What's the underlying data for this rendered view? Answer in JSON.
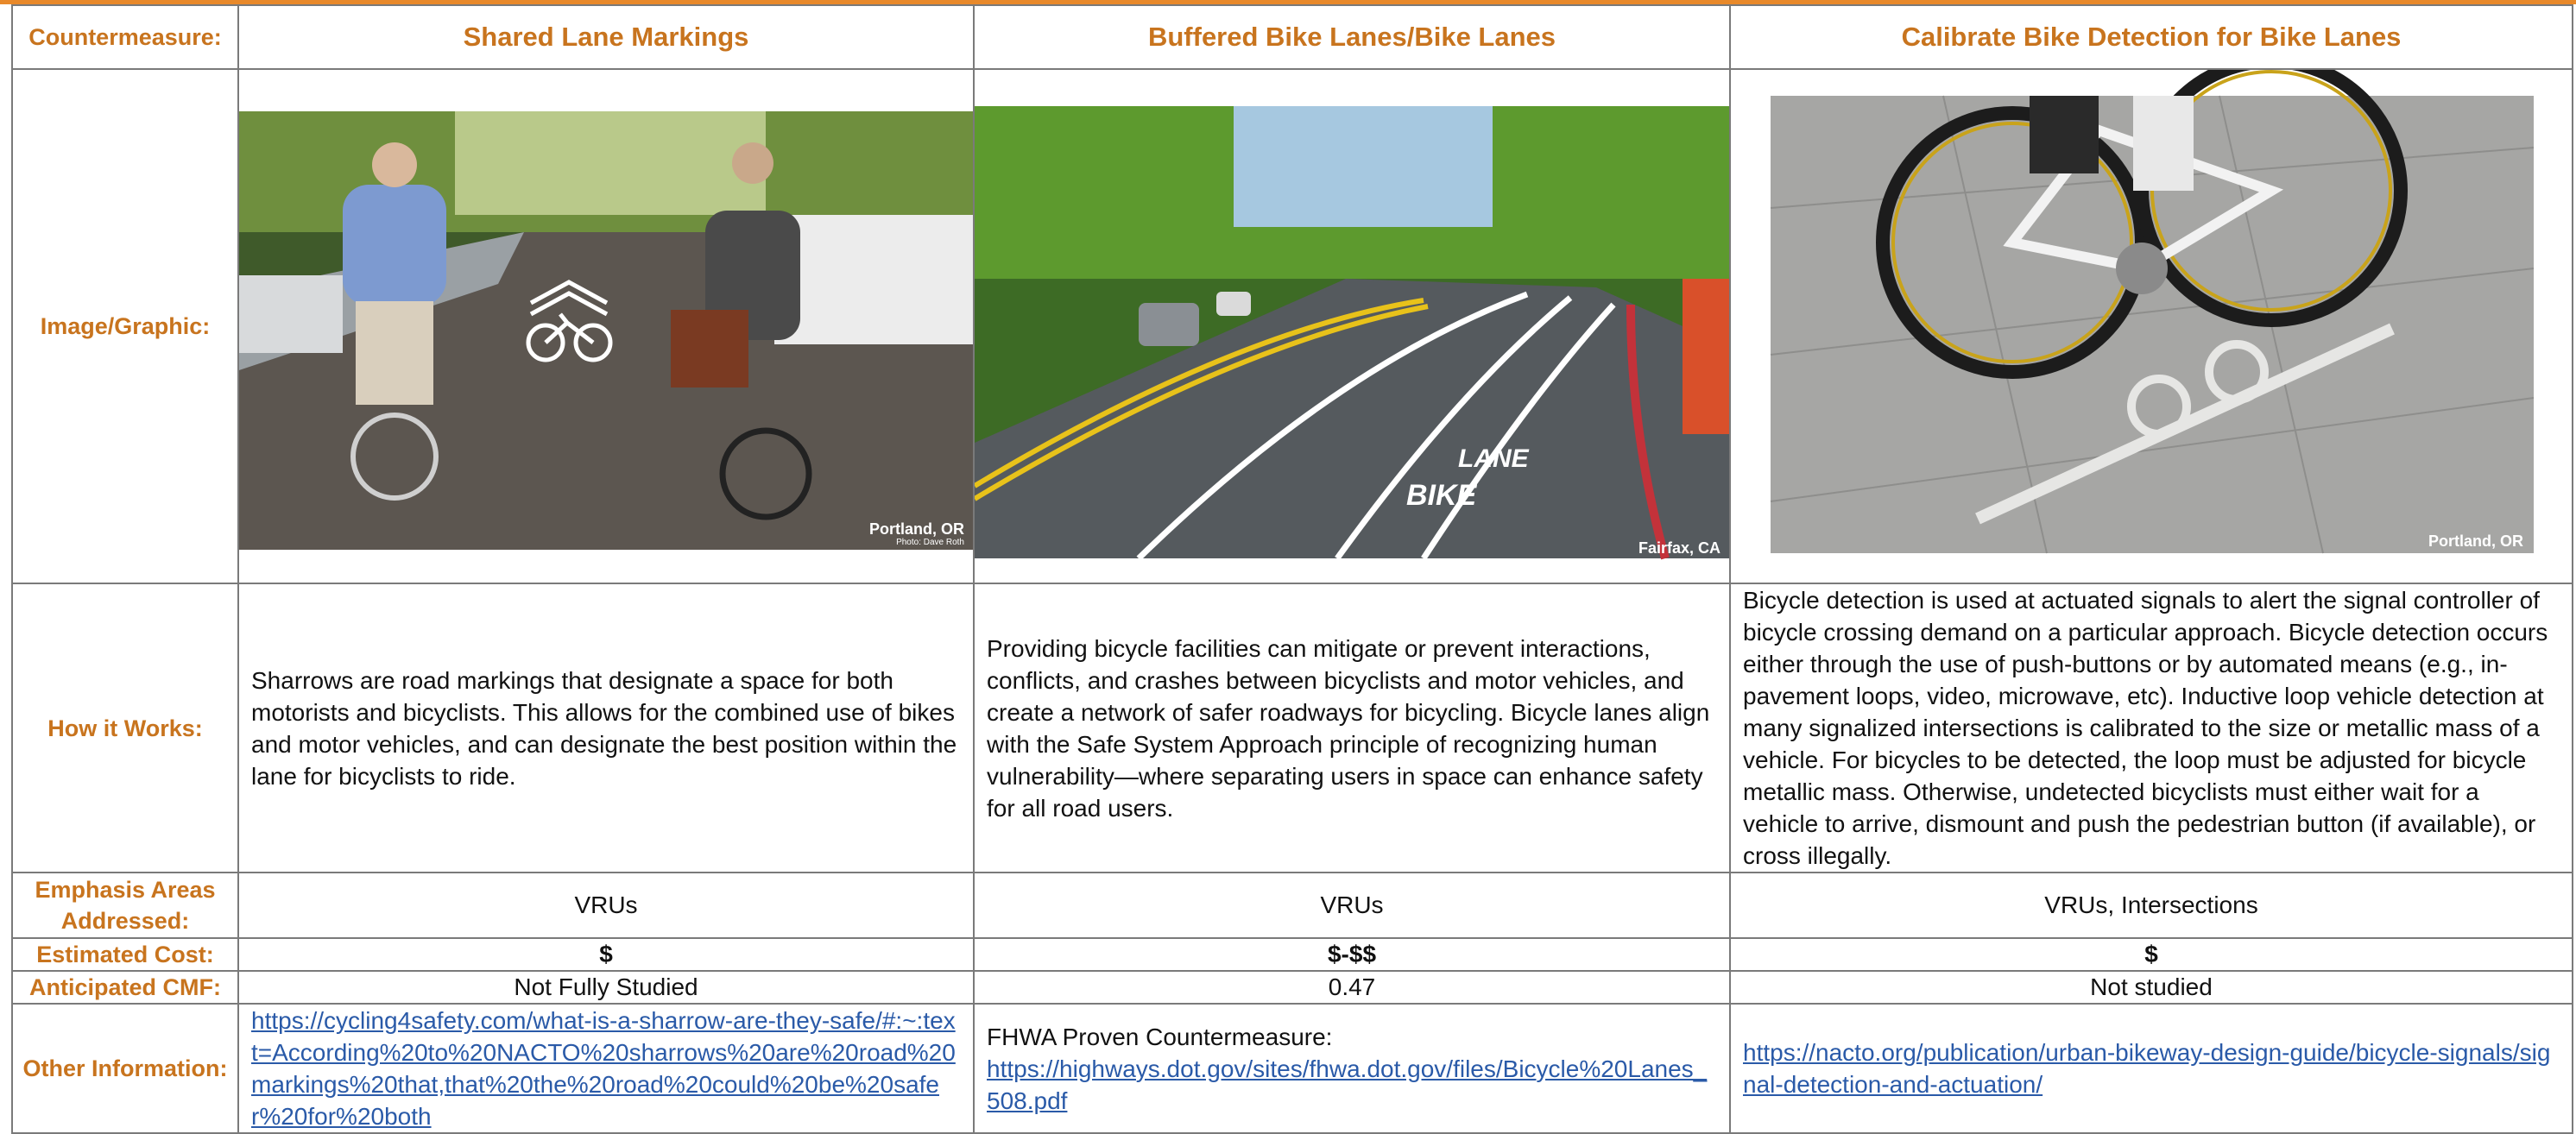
{
  "row_labels": {
    "countermeasure": "Countermeasure:",
    "image": "Image/Graphic:",
    "how": "How it Works:",
    "emphasis": "Emphasis Areas Addressed:",
    "cost": "Estimated Cost:",
    "cmf": "Anticipated CMF:",
    "other": "Other Information:"
  },
  "columns": [
    {
      "title": "Shared Lane Markings",
      "photo_caption": "Portland, OR",
      "photo_credit": "Photo: Dave Roth",
      "how": "Sharrows are road markings that designate a space for both motorists and bicyclists. This allows for the combined use of bikes and motor vehicles, and can designate the best position within the lane for bicyclists to ride.",
      "emphasis": "VRUs",
      "cost": "$",
      "cmf": "Not Fully Studied",
      "other_prefix": "",
      "other_link": "https://cycling4safety.com/what-is-a-sharrow-are-they-safe/#:~:text=According%20to%20NACTO%20sharrows%20are%20road%20markings%20that,that%20the%20road%20could%20be%20safer%20for%20both"
    },
    {
      "title": "Buffered Bike Lanes/Bike Lanes",
      "photo_caption": "Fairfax, CA",
      "photo_credit": "",
      "how": "Providing bicycle facilities can mitigate or prevent interactions, conflicts, and crashes between bicyclists and motor vehicles, and create a network of safer roadways for bicycling. Bicycle lanes align with the Safe System Approach principle of recognizing human vulnerability—where separating users in space can enhance safety for all road users.",
      "emphasis": "VRUs",
      "cost": "$-$$",
      "cmf": "0.47",
      "other_prefix": "FHWA Proven Countermeasure:",
      "other_link": "https://highways.dot.gov/sites/fhwa.dot.gov/files/Bicycle%20Lanes_508.pdf"
    },
    {
      "title": "Calibrate Bike Detection for Bike Lanes",
      "photo_caption": "Portland, OR",
      "photo_credit": "",
      "how": "Bicycle detection is used at actuated signals to alert the signal controller of bicycle crossing demand on a particular approach. Bicycle detection occurs either through the use of push-buttons or by automated means (e.g., in-pavement loops, video, microwave, etc). Inductive loop vehicle detection at many signalized intersections is calibrated to the size or metallic mass of a vehicle. For bicycles to be detected, the loop must be adjusted for bicycle metallic mass. Otherwise, undetected bicyclists must either wait for a vehicle to arrive, dismount and push the pedestrian button (if available), or cross illegally.",
      "emphasis": "VRUs, Intersections",
      "cost": "$",
      "cmf": "Not studied",
      "other_prefix": "",
      "other_link": "https://nacto.org/publication/urban-bikeway-design-guide/bicycle-signals/signal-detection-and-actuation/"
    }
  ],
  "colors": {
    "label_orange": "#c8741e",
    "link_blue": "#2a5aa8",
    "border_gray": "#7a7a7a"
  }
}
